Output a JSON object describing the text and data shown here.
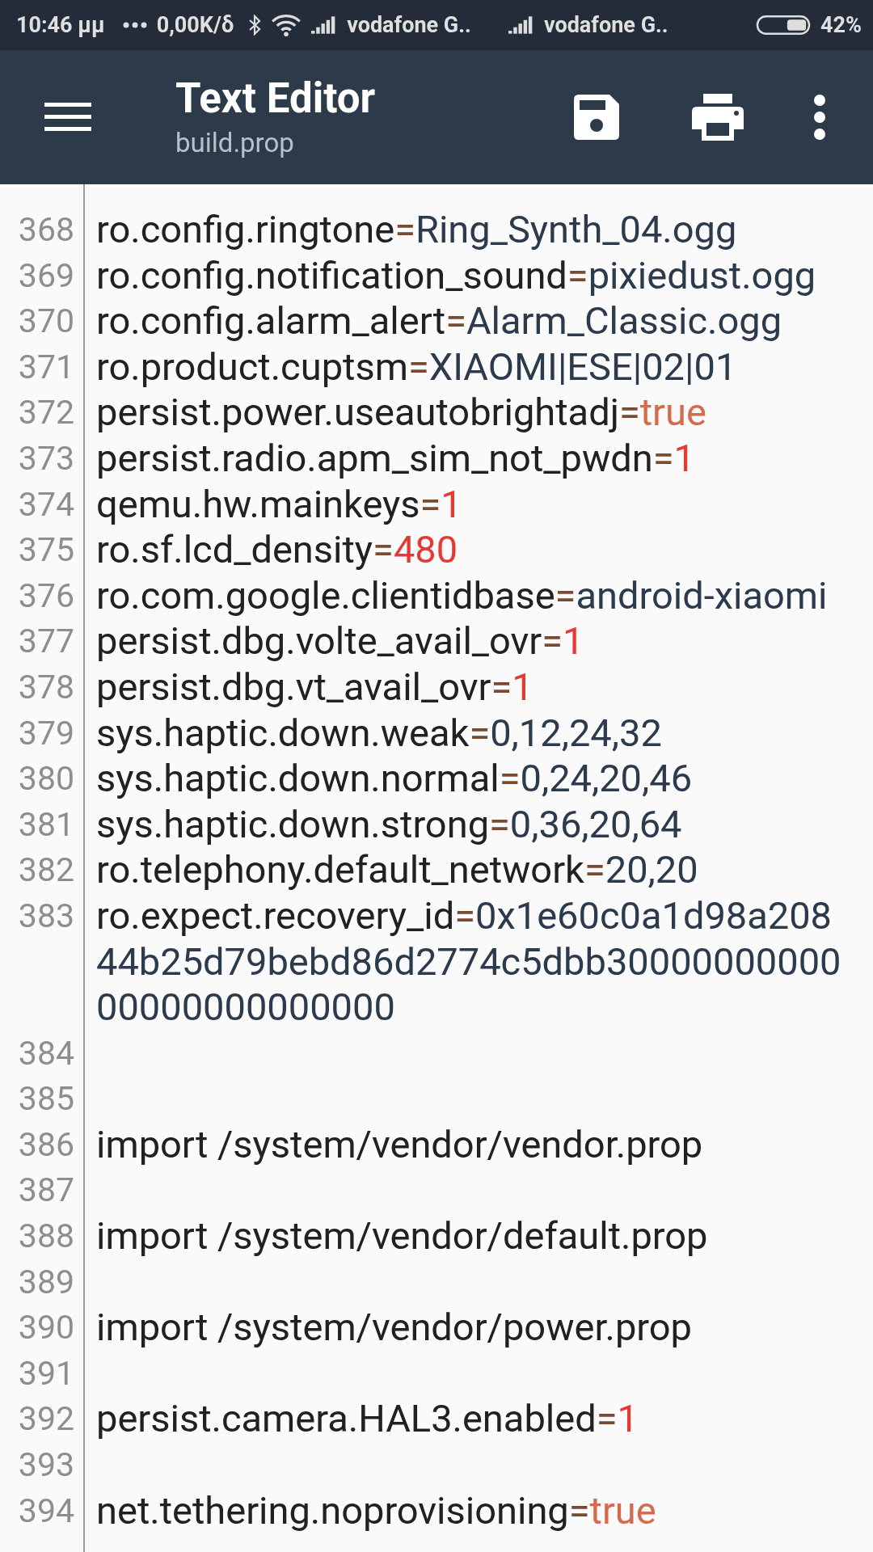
{
  "status_bar": {
    "time": "10:46 μμ",
    "speed": "0,00K/δ",
    "carriers": [
      "vodafone G..",
      "vodafone G.."
    ],
    "battery": "42%"
  },
  "toolbar": {
    "title": "Text Editor",
    "subtitle": "build.prop"
  },
  "lines": [
    {
      "number": "368",
      "key": "ro.config.ringtone",
      "separator": "=",
      "value": "Ring_Synth_04.ogg",
      "kind": "string"
    },
    {
      "number": "369",
      "key": "ro.config.notification_sound",
      "separator": "=",
      "value": "pixiedust.ogg",
      "kind": "string"
    },
    {
      "number": "370",
      "key": "ro.config.alarm_alert",
      "separator": "=",
      "value": "Alarm_Classic.ogg",
      "kind": "string"
    },
    {
      "number": "371",
      "key": "ro.product.cuptsm",
      "separator": "=",
      "value": "XIAOMI|ESE|02|01",
      "kind": "string"
    },
    {
      "number": "372",
      "key": "persist.power.useautobrightadj",
      "separator": "=",
      "value": "true",
      "kind": "bool"
    },
    {
      "number": "373",
      "key": "persist.radio.apm_sim_not_pwdn",
      "separator": "=",
      "value": "1",
      "kind": "number"
    },
    {
      "number": "374",
      "key": "qemu.hw.mainkeys",
      "separator": "=",
      "value": "1",
      "kind": "number"
    },
    {
      "number": "375",
      "key": "ro.sf.lcd_density",
      "separator": "=",
      "value": "480",
      "kind": "number"
    },
    {
      "number": "376",
      "key": "ro.com.google.clientidbase",
      "separator": "=",
      "value": "android-xiaomi",
      "kind": "string"
    },
    {
      "number": "377",
      "key": "persist.dbg.volte_avail_ovr",
      "separator": "=",
      "value": "1",
      "kind": "number"
    },
    {
      "number": "378",
      "key": "persist.dbg.vt_avail_ovr",
      "separator": "=",
      "value": "1",
      "kind": "number"
    },
    {
      "number": "379",
      "key": "sys.haptic.down.weak",
      "separator": "=",
      "value": "0,12,24,32",
      "kind": "string"
    },
    {
      "number": "380",
      "key": "sys.haptic.down.normal",
      "separator": "=",
      "value": "0,24,20,46",
      "kind": "string"
    },
    {
      "number": "381",
      "key": "sys.haptic.down.strong",
      "separator": "=",
      "value": "0,36,20,64",
      "kind": "string"
    },
    {
      "number": "382",
      "key": "ro.telephony.default_network",
      "separator": "=",
      "value": "20,20",
      "kind": "string"
    },
    {
      "number": "383",
      "key": "ro.expect.recovery_id",
      "separator": "=",
      "value": "0x1e60c0a1d98a20844b25d79bebd86d2774c5dbb3000000000000000000000000",
      "kind": "string"
    },
    {
      "number": "384"
    },
    {
      "number": "385"
    },
    {
      "number": "386",
      "key": "import /system/vendor/vendor.prop"
    },
    {
      "number": "387"
    },
    {
      "number": "388",
      "key": "import /system/vendor/default.prop"
    },
    {
      "number": "389"
    },
    {
      "number": "390",
      "key": "import /system/vendor/power.prop"
    },
    {
      "number": "391"
    },
    {
      "number": "392",
      "key": "persist.camera.HAL3.enabled",
      "separator": "=",
      "value": "1",
      "kind": "number"
    },
    {
      "number": "393"
    },
    {
      "number": "394",
      "key": "net.tethering.noprovisioning",
      "separator": "=",
      "value": "true",
      "kind": "bool"
    }
  ]
}
